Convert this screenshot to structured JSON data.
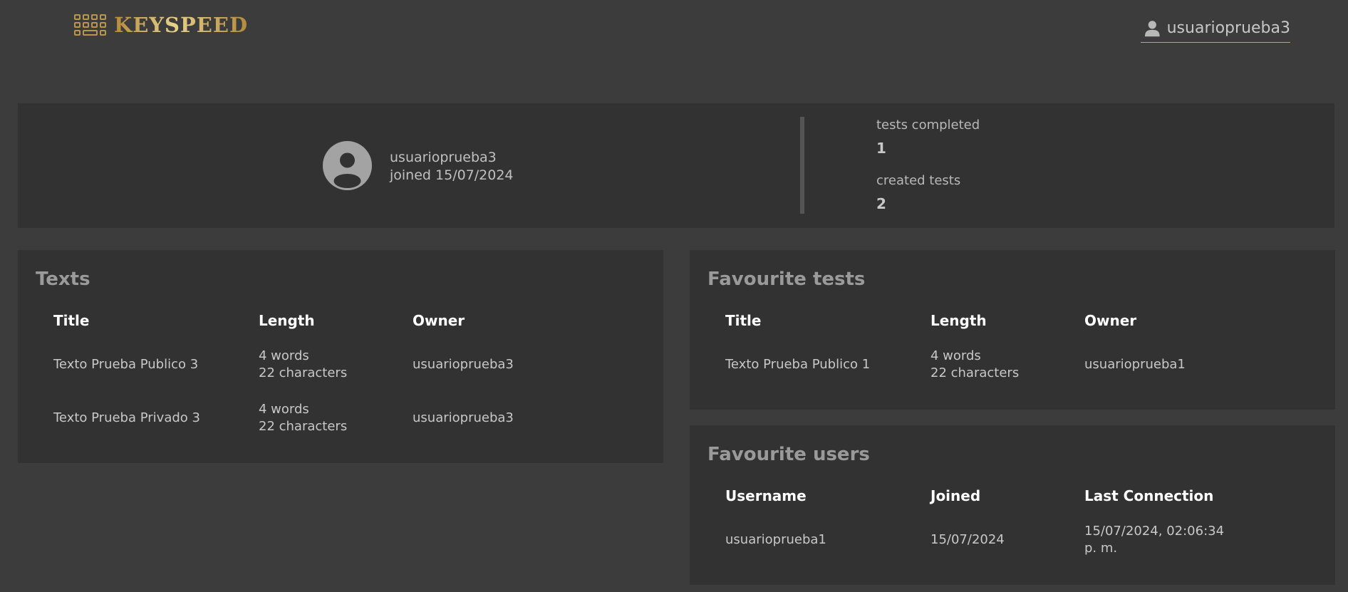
{
  "header": {
    "brand": "KEYSPEED",
    "username": "usuarioprueba3"
  },
  "profile": {
    "username": "usuarioprueba3",
    "joined": "joined 15/07/2024",
    "tests_completed_label": "tests completed",
    "tests_completed_value": "1",
    "created_tests_label": "created tests",
    "created_tests_value": "2"
  },
  "texts": {
    "title": "Texts",
    "columns": [
      "Title",
      "Length",
      "Owner"
    ],
    "rows": [
      {
        "title": "Texto Prueba Publico 3",
        "words": "4 words",
        "chars": "22 characters",
        "owner": "usuarioprueba3"
      },
      {
        "title": "Texto Prueba Privado 3",
        "words": "4 words",
        "chars": "22 characters",
        "owner": "usuarioprueba3"
      }
    ]
  },
  "favourite_tests": {
    "title": "Favourite tests",
    "columns": [
      "Title",
      "Length",
      "Owner"
    ],
    "rows": [
      {
        "title": "Texto Prueba Publico 1",
        "words": "4 words",
        "chars": "22 characters",
        "owner": "usuarioprueba1"
      }
    ]
  },
  "favourite_users": {
    "title": "Favourite users",
    "columns": [
      "Username",
      "Joined",
      "Last Connection"
    ],
    "rows": [
      {
        "username": "usuarioprueba1",
        "joined": "15/07/2024",
        "last_connection_1": "15/07/2024, 02:06:34",
        "last_connection_2": "p. m."
      }
    ]
  },
  "colors": {
    "background": "#3c3c3c",
    "panel": "#323233",
    "accent_gold": "#c9a55c"
  },
  "icons": {
    "logo": "keyboard-icon",
    "user_menu": "user-icon",
    "avatar": "user-avatar-icon"
  }
}
